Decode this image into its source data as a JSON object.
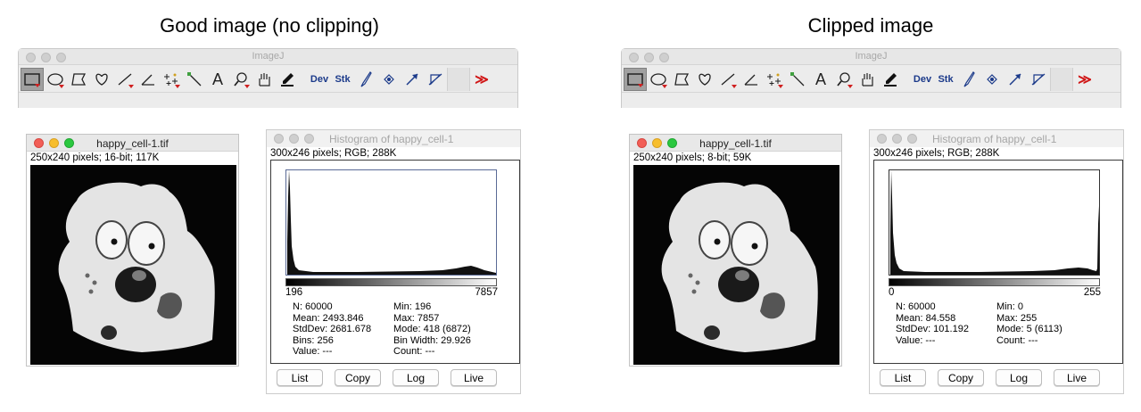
{
  "panels": [
    {
      "heading": "Good image (no clipping)",
      "toolbar_window_title": "ImageJ",
      "image_window": {
        "title": "happy_cell-1.tif",
        "info": "250x240 pixels; 16-bit; 117K"
      },
      "histogram_window": {
        "title": "Histogram of happy_cell-1",
        "info": "300x246 pixels; RGB; 288K",
        "range_min": "196",
        "range_max": "7857",
        "stats_col1": [
          "N: 60000",
          "Mean: 2493.846",
          "StdDev: 2681.678",
          "Bins: 256",
          "Value: ---"
        ],
        "stats_col2": [
          "Min: 196",
          "Max: 7857",
          "Mode: 418 (6872)",
          "Bin Width: 29.926",
          "Count: ---"
        ],
        "buttons": [
          "List",
          "Copy",
          "Log",
          "Live"
        ]
      }
    },
    {
      "heading": "Clipped image",
      "toolbar_window_title": "ImageJ",
      "image_window": {
        "title": "happy_cell-1.tif",
        "info": "250x240 pixels; 8-bit; 59K"
      },
      "histogram_window": {
        "title": "Histogram of happy_cell-1",
        "info": "300x246 pixels; RGB; 288K",
        "range_min": "0",
        "range_max": "255",
        "stats_col1": [
          "N: 60000",
          "Mean: 84.558",
          "StdDev: 101.192",
          "Value: ---"
        ],
        "stats_col2": [
          "Min: 0",
          "Max: 255",
          "Mode: 5 (6113)",
          "Count: ---"
        ],
        "buttons": [
          "List",
          "Copy",
          "Log",
          "Live"
        ]
      }
    }
  ],
  "toolbar": {
    "icons": [
      "rectangle-tool-icon",
      "oval-tool-icon",
      "polygon-tool-icon",
      "freehand-tool-icon",
      "line-tool-icon",
      "angle-tool-icon",
      "multipoint-tool-icon",
      "wand-tool-icon",
      "text-tool-icon",
      "magnifier-tool-icon",
      "hand-tool-icon",
      "color-picker-tool-icon",
      "dev-menu-icon",
      "stack-menu-icon",
      "brush-tool-icon",
      "flood-fill-tool-icon",
      "arrow-tool-icon",
      "angle-measure-tool-icon",
      "more-tools-icon"
    ],
    "text_tool": "A",
    "dev_label": "Dev",
    "stk_label": "Stk",
    "more_label": "≫"
  },
  "colors": {
    "titlebar_text": "#a6a6a6",
    "tool_dropdown_triangle": "#d02020",
    "close_button": "#f25f57",
    "minimize_button": "#f7be2d",
    "zoom_button": "#2bc840"
  }
}
